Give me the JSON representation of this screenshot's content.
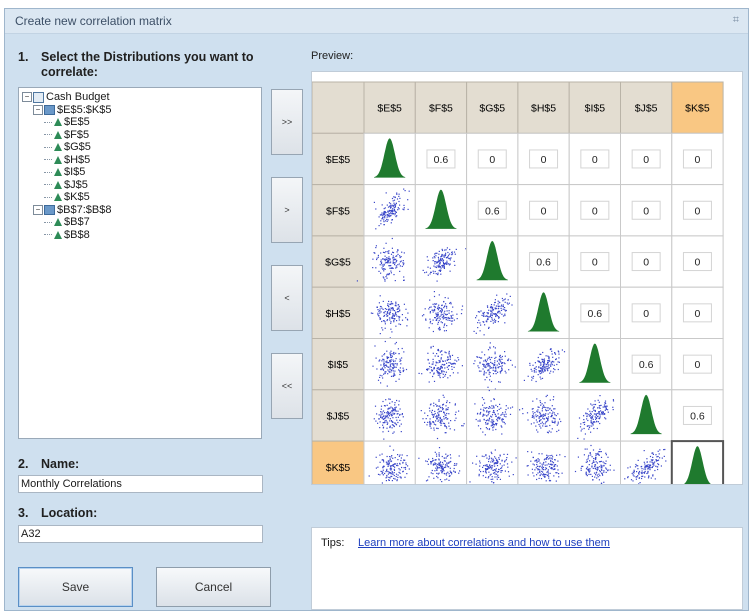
{
  "window": {
    "title": "Create new correlation matrix",
    "close_glyph": "⌗"
  },
  "section1": {
    "number": "1.",
    "label": "Select the Distributions you want to correlate:"
  },
  "tree": [
    {
      "label": "Cash Budget",
      "level": 0,
      "icon": "workbook-icon",
      "expand": "−"
    },
    {
      "label": "$E$5:$K$5",
      "level": 1,
      "icon": "range-icon",
      "expand": "−"
    },
    {
      "label": "$E$5",
      "level": 2,
      "icon": "distribution-icon"
    },
    {
      "label": "$F$5",
      "level": 2,
      "icon": "distribution-icon"
    },
    {
      "label": "$G$5",
      "level": 2,
      "icon": "distribution-icon"
    },
    {
      "label": "$H$5",
      "level": 2,
      "icon": "distribution-icon"
    },
    {
      "label": "$I$5",
      "level": 2,
      "icon": "distribution-icon"
    },
    {
      "label": "$J$5",
      "level": 2,
      "icon": "distribution-icon"
    },
    {
      "label": "$K$5",
      "level": 2,
      "icon": "distribution-icon"
    },
    {
      "label": "$B$7:$B$8",
      "level": 1,
      "icon": "range-icon",
      "expand": "−"
    },
    {
      "label": "$B$7",
      "level": 2,
      "icon": "distribution-icon"
    },
    {
      "label": "$B$8",
      "level": 2,
      "icon": "distribution-icon"
    }
  ],
  "move_buttons": [
    ">>",
    ">",
    "<",
    "<<"
  ],
  "section2": {
    "number": "2.",
    "label": "Name:",
    "value": "Monthly Correlations"
  },
  "section3": {
    "number": "3.",
    "label": "Location:",
    "value": "A32"
  },
  "buttons": {
    "save": "Save",
    "cancel": "Cancel"
  },
  "preview": {
    "label": "Preview:",
    "variables": [
      "$E$5",
      "$F$5",
      "$G$5",
      "$H$5",
      "$I$5",
      "$J$5",
      "$K$5"
    ],
    "highlighted": "$K$5",
    "correlations": [
      [
        "dist",
        "0.6",
        "0",
        "0",
        "0",
        "0",
        "0"
      ],
      [
        "scatter",
        "dist",
        "0.6",
        "0",
        "0",
        "0",
        "0"
      ],
      [
        "scatter",
        "scatter",
        "dist",
        "0.6",
        "0",
        "0",
        "0"
      ],
      [
        "scatter",
        "scatter",
        "scatter",
        "dist",
        "0.6",
        "0",
        "0"
      ],
      [
        "scatter",
        "scatter",
        "scatter",
        "scatter",
        "dist",
        "0.6",
        "0"
      ],
      [
        "scatter",
        "scatter",
        "scatter",
        "scatter",
        "scatter",
        "dist",
        "0.6"
      ],
      [
        "scatter",
        "scatter",
        "scatter",
        "scatter",
        "scatter",
        "scatter",
        "dist"
      ]
    ],
    "colors": {
      "header_bg": "#e3ddd1",
      "highlight_bg": "#f9c783",
      "distribution": "#1f7a2e",
      "scatter": "#3a47c9"
    }
  },
  "tips": {
    "label": "Tips:",
    "link": "Learn more about correlations and how to use them"
  }
}
